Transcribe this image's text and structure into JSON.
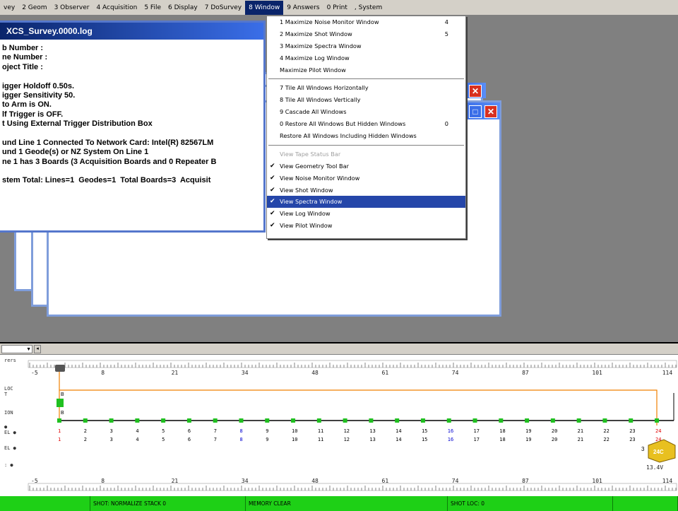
{
  "menubar": {
    "items": [
      "vey",
      "2 Geom",
      "3 Observer",
      "4 Acquisition",
      "5 File",
      "6 Display",
      "7 DoSurvey",
      "8 Window",
      "9 Answers",
      "0 Print",
      ", System"
    ],
    "active_index": 7
  },
  "log_window": {
    "title": "XCS_Survey.0000.log",
    "lines": [
      "b Number :",
      "ne Number :",
      "oject Title :",
      "",
      "igger Holdoff 0.50s.",
      "igger Sensitivity 50.",
      "to Arm is ON.",
      "lf Trigger is OFF.",
      "t Using External Trigger Distribution Box",
      "",
      "und Line 1 Connected To Network Card: Intel(R) 82567LM",
      "und 1 Geode(s) or NZ System On Line 1",
      "ne 1 has 3 Boards (3 Acquisition Boards and 0 Repeater B",
      "",
      "stem Total: Lines=1  Geodes=1  Total Boards=3  Acquisit"
    ]
  },
  "window_menu": {
    "items": [
      {
        "label": "1 Maximize Noise Monitor Window",
        "shortcut": "4",
        "checked": false,
        "disabled": false,
        "selected": false
      },
      {
        "label": "2 Maximize Shot Window",
        "shortcut": "5",
        "checked": false,
        "disabled": false,
        "selected": false
      },
      {
        "label": "3 Maximize Spectra Window",
        "shortcut": "",
        "checked": false,
        "disabled": false,
        "selected": false
      },
      {
        "label": "4 Maximize Log Window",
        "shortcut": "",
        "checked": false,
        "disabled": false,
        "selected": false
      },
      {
        "label": "Maximize Pilot Window",
        "shortcut": "",
        "checked": false,
        "disabled": false,
        "selected": false
      },
      {
        "separator": true
      },
      {
        "label": "7 Tile All Windows Horizontally",
        "shortcut": "",
        "checked": false,
        "disabled": false,
        "selected": false
      },
      {
        "label": "8 Tile All Windows Vertically",
        "shortcut": "",
        "checked": false,
        "disabled": false,
        "selected": false
      },
      {
        "label": "9 Cascade All Windows",
        "shortcut": "",
        "checked": false,
        "disabled": false,
        "selected": false
      },
      {
        "label": "0 Restore All Windows But Hidden Windows",
        "shortcut": "0",
        "checked": false,
        "disabled": false,
        "selected": false
      },
      {
        "label": "Restore All Windows Including Hidden Windows",
        "shortcut": "",
        "checked": false,
        "disabled": false,
        "selected": false
      },
      {
        "separator": true
      },
      {
        "label": "View Tape Status Bar",
        "shortcut": "",
        "checked": false,
        "disabled": true,
        "selected": false
      },
      {
        "label": "View Geometry Tool Bar",
        "shortcut": "",
        "checked": true,
        "disabled": false,
        "selected": false
      },
      {
        "label": "View Noise Monitor Window",
        "shortcut": "",
        "checked": true,
        "disabled": false,
        "selected": false
      },
      {
        "label": "View Shot Window",
        "shortcut": "",
        "checked": true,
        "disabled": false,
        "selected": false
      },
      {
        "label": "View Spectra  Window",
        "shortcut": "",
        "checked": true,
        "disabled": false,
        "selected": true
      },
      {
        "label": "View Log Window",
        "shortcut": "",
        "checked": true,
        "disabled": false,
        "selected": false
      },
      {
        "label": "View Pilot Window",
        "shortcut": "",
        "checked": true,
        "disabled": false,
        "selected": false
      }
    ]
  },
  "geometry": {
    "row_labels": [
      "rers",
      "LOC",
      "T",
      "ION",
      "●",
      "EL ●",
      "EL ●",
      ": ●"
    ],
    "top_ruler_labels": [
      "-5",
      "8",
      "21",
      "34",
      "48",
      "61",
      "74",
      "87",
      "101",
      "114"
    ],
    "bottom_ruler_labels": [
      "-5",
      "8",
      "21",
      "34",
      "48",
      "61",
      "74",
      "87",
      "101",
      "114"
    ],
    "stations": [
      {
        "a": "1",
        "b": "1",
        "color": "#e00000"
      },
      {
        "a": "2",
        "b": "2",
        "color": "#000000"
      },
      {
        "a": "3",
        "b": "3",
        "color": "#000000"
      },
      {
        "a": "4",
        "b": "4",
        "color": "#000000"
      },
      {
        "a": "5",
        "b": "5",
        "color": "#000000"
      },
      {
        "a": "6",
        "b": "6",
        "color": "#000000"
      },
      {
        "a": "7",
        "b": "7",
        "color": "#000000"
      },
      {
        "a": "8",
        "b": "8",
        "color": "#0000d0"
      },
      {
        "a": "9",
        "b": "9",
        "color": "#000000"
      },
      {
        "a": "10",
        "b": "10",
        "color": "#000000"
      },
      {
        "a": "11",
        "b": "11",
        "color": "#000000"
      },
      {
        "a": "12",
        "b": "12",
        "color": "#000000"
      },
      {
        "a": "13",
        "b": "13",
        "color": "#000000"
      },
      {
        "a": "14",
        "b": "14",
        "color": "#000000"
      },
      {
        "a": "15",
        "b": "15",
        "color": "#000000"
      },
      {
        "a": "16",
        "b": "16",
        "color": "#0000d0"
      },
      {
        "a": "17",
        "b": "17",
        "color": "#000000"
      },
      {
        "a": "18",
        "b": "18",
        "color": "#000000"
      },
      {
        "a": "19",
        "b": "19",
        "color": "#000000"
      },
      {
        "a": "20",
        "b": "20",
        "color": "#000000"
      },
      {
        "a": "21",
        "b": "21",
        "color": "#000000"
      },
      {
        "a": "22",
        "b": "22",
        "color": "#000000"
      },
      {
        "a": "23",
        "b": "23",
        "color": "#000000"
      },
      {
        "a": "24",
        "b": "24",
        "color": "#e00000"
      }
    ],
    "shot_marker_labels": [
      "B",
      "B"
    ],
    "geode_label": "24C",
    "voltage_label": "13.4V",
    "left_number": "3"
  },
  "status_bar": {
    "cells": [
      "",
      "SHOT: NORMALIZE  STACK 0",
      "MEMORY CLEAR",
      "",
      "SHOT LOC: 0",
      ""
    ]
  },
  "colors": {
    "menu_highlight": "#2546a9",
    "title_gradient_start": "#0a246a",
    "status_green": "#1ed016",
    "station_green": "#20c020",
    "shot_line_orange": "#f08000",
    "close_button_red": "#d83020"
  }
}
